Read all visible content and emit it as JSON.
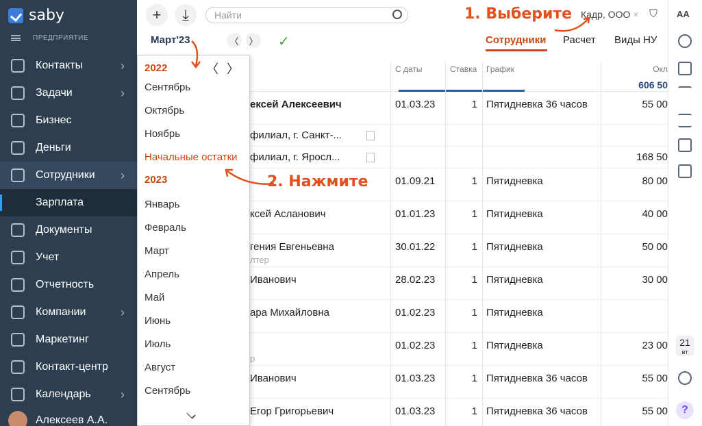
{
  "app": {
    "logo": "saby",
    "company_label": "ПРЕДПРИЯТИЕ"
  },
  "sidebar": {
    "items": [
      {
        "label": "Контакты",
        "icon": "chat-icon",
        "chev": true
      },
      {
        "label": "Задачи",
        "icon": "tasks-icon",
        "chev": true
      },
      {
        "label": "Бизнес",
        "icon": "briefcase-icon",
        "chev": false
      },
      {
        "label": "Деньги",
        "icon": "money-icon",
        "chev": false
      },
      {
        "label": "Сотрудники",
        "icon": "people-icon",
        "chev": true
      },
      {
        "label": "Зарплата",
        "icon": "",
        "chev": false
      },
      {
        "label": "Документы",
        "icon": "paper-plane-icon",
        "chev": false
      },
      {
        "label": "Учет",
        "icon": "accounting-icon",
        "chev": false
      },
      {
        "label": "Отчетность",
        "icon": "report-icon",
        "chev": false
      },
      {
        "label": "Компании",
        "icon": "company-icon",
        "chev": true
      },
      {
        "label": "Маркетинг",
        "icon": "marketing-icon",
        "chev": false
      },
      {
        "label": "Контакт-центр",
        "icon": "headset-icon",
        "chev": false
      },
      {
        "label": "Календарь",
        "icon": "calendar-icon",
        "chev": true
      }
    ],
    "user": "Алексеев А.А."
  },
  "toolbar": {
    "search_placeholder": "Найти",
    "filter_tag": "Кадр, ООО",
    "period": "Март'23",
    "check": "✓"
  },
  "annotations": {
    "step1": "1. Выберите",
    "step2": "2. Нажмите"
  },
  "tabs": [
    {
      "label": "Сотрудники",
      "active": true
    },
    {
      "label": "Расчет",
      "active": false
    },
    {
      "label": "Виды НУ",
      "active": false
    }
  ],
  "table": {
    "headers": {
      "date": "С даты",
      "rate": "Ставка",
      "schedule": "График",
      "salary": "Окл"
    },
    "total": "606 50",
    "rows": [
      {
        "name": "ексей Алексеевич",
        "bold": true,
        "date": "01.03.23",
        "rate": "1",
        "schedule": "Пятидневка 36 часов",
        "salary": "55 00"
      },
      {
        "name": "филиал, г. Санкт-...",
        "building": true,
        "date": "",
        "rate": "",
        "schedule": "",
        "salary": ""
      },
      {
        "name": "филиал, г. Яросл...",
        "building": true,
        "date": "",
        "rate": "",
        "schedule": "",
        "salary": "168 50"
      },
      {
        "name": "",
        "date": "01.09.21",
        "rate": "1",
        "schedule": "Пятидневка",
        "salary": "80 00"
      },
      {
        "name": "ксей Асланович",
        "date": "01.01.23",
        "rate": "1",
        "schedule": "Пятидневка",
        "salary": "40 00"
      },
      {
        "name": "гения Евгеньевна",
        "sub": "лтер",
        "date": "30.01.22",
        "rate": "1",
        "schedule": "Пятидневка",
        "salary": "50 00"
      },
      {
        "name": "Иванович",
        "date": "28.02.23",
        "rate": "1",
        "schedule": "Пятидневка",
        "salary": "30 00"
      },
      {
        "name": "ара Михайловна",
        "date": "01.02.23",
        "rate": "1",
        "schedule": "Пятидневка",
        "salary": ""
      },
      {
        "name": "",
        "sub": "р",
        "date": "01.02.23",
        "rate": "1",
        "schedule": "Пятидневка",
        "salary": "23 00"
      },
      {
        "name": "Иванович",
        "date": "01.03.23",
        "rate": "1",
        "schedule": "Пятидневка 36 часов",
        "salary": "55 00"
      },
      {
        "name": "Егор Григорьевич",
        "date": "01.03.23",
        "rate": "1",
        "schedule": "Пятидневка 36 часов",
        "salary": "55 00"
      }
    ]
  },
  "dropdown": {
    "year_top": "2022",
    "prev": "〈",
    "next": "〉",
    "items_2022": [
      "Сентябрь",
      "Октябрь",
      "Ноябрь",
      "Начальные остатки"
    ],
    "year2": "2023",
    "items_2023": [
      "Январь",
      "Февраль",
      "Март",
      "Апрель",
      "Май",
      "Июнь",
      "Июль",
      "Август",
      "Сентябрь"
    ]
  },
  "rightbar": {
    "day": "21",
    "weekday": "вт",
    "font_label": "АА",
    "help": "?"
  },
  "colors": {
    "sidebar": "#2c3e50",
    "accent": "#c94a10",
    "annotation": "#e2511c"
  }
}
